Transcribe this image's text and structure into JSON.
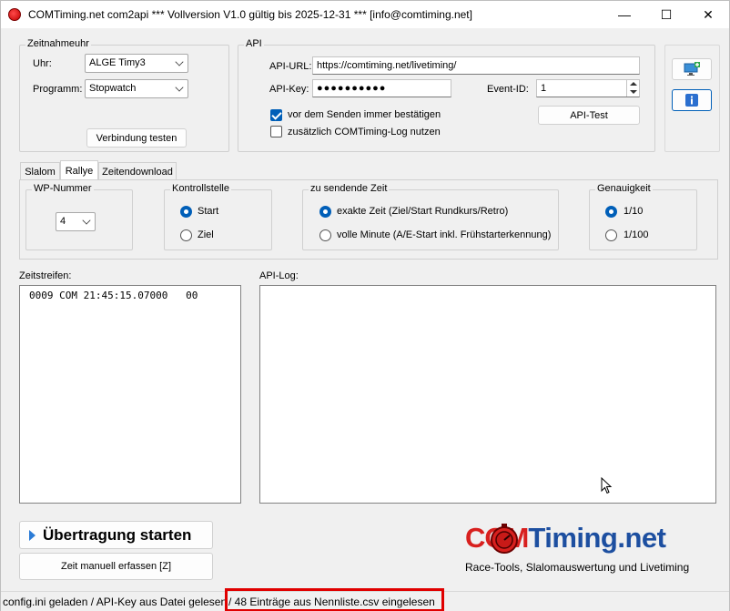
{
  "window": {
    "title": "COMTiming.net com2api *** Vollversion V1.0 gültig bis 2025-12-31 *** [info@comtiming.net]",
    "minimize": "—",
    "maximize": "☐",
    "close": "✕"
  },
  "zeitnahmeuhr": {
    "legend": "Zeitnahmeuhr",
    "uhr_label": "Uhr:",
    "uhr_value": "ALGE Timy3",
    "programm_label": "Programm:",
    "programm_value": "Stopwatch",
    "test_button": "Verbindung testen"
  },
  "api": {
    "legend": "API",
    "url_label": "API-URL:",
    "url_value": "https://comtiming.net/livetiming/",
    "key_label": "API-Key:",
    "key_value": "●●●●●●●●●●",
    "event_label": "Event-ID:",
    "event_value": "1",
    "confirm_label": "vor dem Senden immer bestätigen",
    "confirm_checked": true,
    "log_label": "zusätzlich COMTiming-Log nutzen",
    "log_checked": false,
    "test_button": "API-Test"
  },
  "tabs": [
    {
      "label": "Slalom",
      "active": false
    },
    {
      "label": "Rallye",
      "active": true
    },
    {
      "label": "Zeitendownload",
      "active": false
    }
  ],
  "rallye": {
    "wp_legend": "WP-Nummer",
    "wp_value": "4",
    "kontroll_legend": "Kontrollstelle",
    "kontroll_options": [
      "Start",
      "Ziel"
    ],
    "kontroll_selected": "Start",
    "zeit_legend": "zu sendende Zeit",
    "zeit_options": [
      "exakte Zeit (Ziel/Start Rundkurs/Retro)",
      "volle Minute (A/E-Start inkl. Frühstarterkennung)"
    ],
    "zeit_selected": "exakte Zeit (Ziel/Start Rundkurs/Retro)",
    "genau_legend": "Genauigkeit",
    "genau_options": [
      "1/10",
      "1/100"
    ],
    "genau_selected": "1/10"
  },
  "zeitstreifen": {
    "label": "Zeitstreifen:",
    "lines": [
      "0009 COM 21:45:15.07000   00"
    ]
  },
  "apilog": {
    "label": "API-Log:",
    "lines": []
  },
  "buttons": {
    "start": "Übertragung starten",
    "manual": "Zeit manuell erfassen [Z]"
  },
  "logo": {
    "text_com": "COM",
    "text_timing": "Timing.net",
    "tagline": "Race-Tools, Slalomauswertung und Livetiming"
  },
  "status": {
    "part1": "config.ini geladen / API-Key aus Datei gelesen",
    "part2": "/ 48 Einträge aus Nennliste.csv eingelesen"
  },
  "colors": {
    "accent": "#005fb8",
    "logo_red": "#d8201e",
    "logo_blue": "#1d4fa0",
    "highlight": "#e00000"
  }
}
